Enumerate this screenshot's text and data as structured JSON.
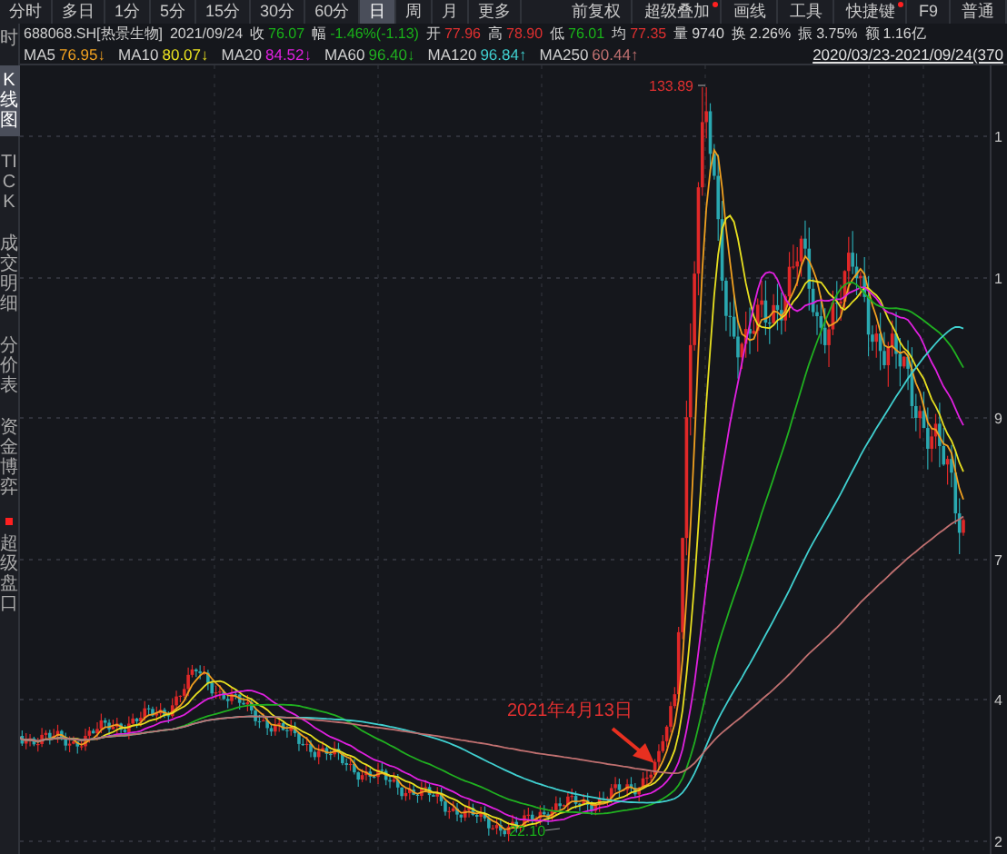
{
  "toolbar": {
    "periods": [
      {
        "label": "分时",
        "selected": false
      },
      {
        "label": "多日",
        "selected": false
      },
      {
        "label": "1分",
        "selected": false
      },
      {
        "label": "5分",
        "selected": false
      },
      {
        "label": "15分",
        "selected": false
      },
      {
        "label": "30分",
        "selected": false
      },
      {
        "label": "60分",
        "selected": false
      },
      {
        "label": "日",
        "selected": true
      },
      {
        "label": "周",
        "selected": false
      },
      {
        "label": "月",
        "selected": false
      },
      {
        "label": "更多",
        "selected": false
      }
    ],
    "tools": [
      {
        "label": "前复权",
        "dot": false
      },
      {
        "label": "超级叠加",
        "dot": true
      },
      {
        "label": "画线",
        "dot": false
      },
      {
        "label": "工具",
        "dot": false
      },
      {
        "label": "快捷键",
        "dot": true
      },
      {
        "label": "F9",
        "dot": false
      },
      {
        "label": "普通",
        "dot": false
      }
    ]
  },
  "quote": {
    "symbol": "688068.SH[热景生物]",
    "date": "2021/09/24",
    "fields": [
      {
        "label": "收",
        "value": "76.07",
        "color": "#19b219"
      },
      {
        "label": "幅",
        "value": "-1.46%(-1.13)",
        "color": "#19b219"
      },
      {
        "label": "开",
        "value": "77.96",
        "color": "#e03030"
      },
      {
        "label": "高",
        "value": "78.90",
        "color": "#e03030"
      },
      {
        "label": "低",
        "value": "76.01",
        "color": "#19b219"
      },
      {
        "label": "均",
        "value": "77.35",
        "color": "#e03030"
      },
      {
        "label": "量",
        "value": "9740",
        "color": "#d8d8d8"
      },
      {
        "label": "换",
        "value": "2.26%",
        "color": "#d8d8d8"
      },
      {
        "label": "振",
        "value": "3.75%",
        "color": "#d8d8d8"
      },
      {
        "label": "额",
        "value": "1.16亿",
        "color": "#d8d8d8"
      }
    ]
  },
  "moving_averages": [
    {
      "label": "MA5",
      "value": "76.95↓",
      "color": "#f0a020"
    },
    {
      "label": "MA10",
      "value": "80.07↓",
      "color": "#e8e020"
    },
    {
      "label": "MA20",
      "value": "84.52↓",
      "color": "#e020e0"
    },
    {
      "label": "MA60",
      "value": "96.40↓",
      "color": "#20b020"
    },
    {
      "label": "MA120",
      "value": "96.84↑",
      "color": "#40d0d0"
    },
    {
      "label": "MA250",
      "value": "60.44↑",
      "color": "#c07070"
    }
  ],
  "date_range": "2020/03/23-2021/09/24(370",
  "sidebar": [
    {
      "label": "时",
      "selected": false,
      "dot": false
    },
    {
      "label": "K线图",
      "selected": true,
      "dot": false
    },
    {
      "label": "TICK",
      "selected": false,
      "dot": false
    },
    {
      "label": "成交明细",
      "selected": false,
      "dot": false
    },
    {
      "label": "分价表",
      "selected": false,
      "dot": false
    },
    {
      "label": "资金博弈",
      "selected": false,
      "dot": false
    },
    {
      "label": "超级盘口",
      "selected": false,
      "dot": true
    }
  ],
  "chart": {
    "high_label": "133.89",
    "low_label": "22.10",
    "annotation": "2021年4月13日",
    "axis_labels": [
      "1",
      "1",
      "9",
      "7",
      "4",
      "2"
    ]
  }
}
